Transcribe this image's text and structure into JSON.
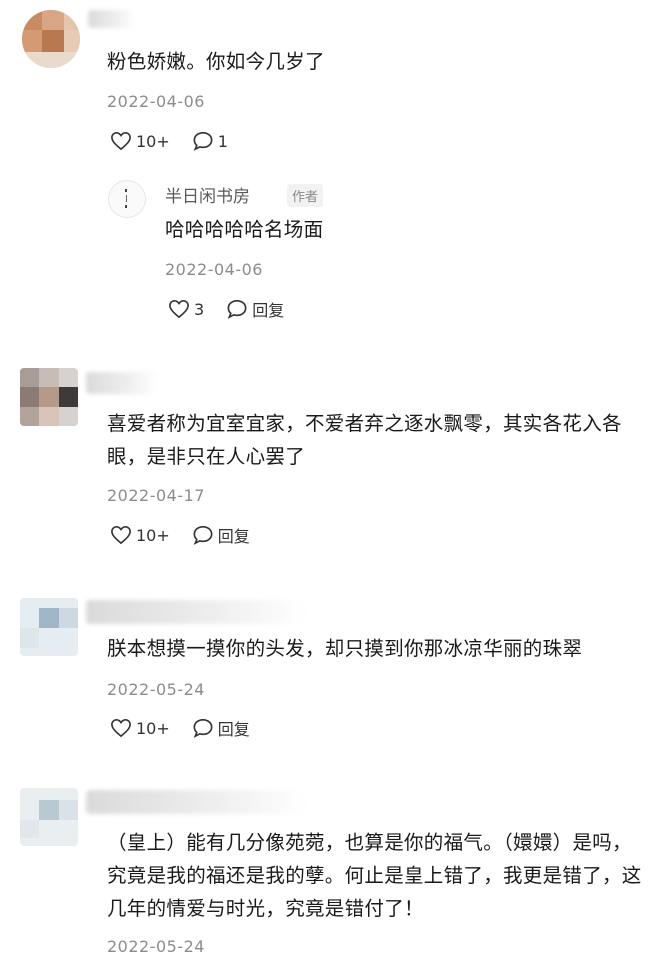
{
  "comments": [
    {
      "text": "粉色娇嫩。你如今几岁了",
      "date": "2022-04-06",
      "likes": "10+",
      "second_action": "1",
      "reply": {
        "author": "半日闲书房",
        "author_tag": "作者",
        "text": "哈哈哈哈哈名场面",
        "date": "2022-04-06",
        "likes": "3",
        "reply_label": "回复"
      }
    },
    {
      "text": "喜爱者称为宜室宜家，不爱者弃之逐水飘零，其实各花入各眼，是非只在人心罢了",
      "date": "2022-04-17",
      "likes": "10+",
      "second_action": "回复"
    },
    {
      "text": "朕本想摸一摸你的头发，却只摸到你那冰凉华丽的珠翠",
      "date": "2022-05-24",
      "likes": "10+",
      "second_action": "回复"
    },
    {
      "text": "（皇上）能有几分像苑菀，也算是你的福气。（嬛嬛）是吗，究竟是我的福还是我的孽。何止是皇上错了，我更是错了，这几年的情爱与时光，究竟是错付了！",
      "date": "2022-05-24"
    }
  ],
  "icons": {
    "like": "heart-outline-icon",
    "comment": "speech-bubble-icon"
  },
  "colors": {
    "text": "#1a1a1a",
    "meta": "#8c8c8c",
    "background": "#ffffff"
  }
}
